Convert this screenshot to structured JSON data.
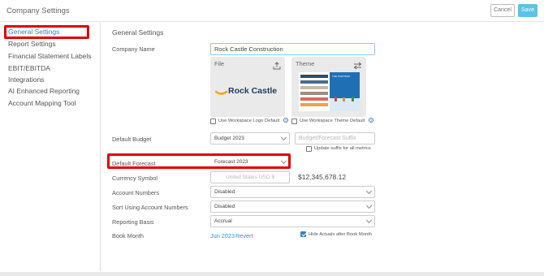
{
  "app": {
    "title": "Company Settings"
  },
  "toolbar": {
    "cancel_label": "Cancel",
    "save_label": "Save"
  },
  "sidebar": {
    "items": [
      {
        "label": "General Settings"
      },
      {
        "label": "Report Settings"
      },
      {
        "label": "Financial Statement Labels"
      },
      {
        "label": "EBIT/EBITDA"
      },
      {
        "label": "Integrations"
      },
      {
        "label": "AI Enhanced Reporting"
      },
      {
        "label": "Account Mapping Tool"
      }
    ],
    "active_index": 0
  },
  "main": {
    "section_title": "General Settings",
    "company_name": {
      "label": "Company Name",
      "value": "Rock Castle Construction"
    },
    "file_panel": {
      "label": "File",
      "logo_text": "Rock Castle",
      "use_default_label": "Use Workspace Logo Default"
    },
    "theme_panel": {
      "label": "Theme",
      "preview_title": "THE FORTISON",
      "use_default_label": "Use Workspace Theme Default"
    },
    "default_budget": {
      "label": "Default Budget",
      "value": "Budget 2023",
      "suffix_placeholder": "Budget/Forecast Suffix",
      "update_suffix_label": "Update suffix for all metrics"
    },
    "default_forecast": {
      "label": "Default Forecast",
      "value": "Forecast 2023"
    },
    "currency_symbol": {
      "label": "Currency Symbol",
      "placeholder": "United States USD $",
      "example": "$12,345,678.12"
    },
    "account_numbers": {
      "label": "Account Numbers",
      "value": "Disabled"
    },
    "sort_account_numbers": {
      "label": "Sort Using Account Numbers",
      "value": "Disabled"
    },
    "reporting_basis": {
      "label": "Reporting Basis",
      "value": "Accrual"
    },
    "book_month": {
      "label": "Book Month",
      "value": "Jun 2023",
      "revert_label": "Revert",
      "hide_actuals_label": "Hide Actuals after Book Month"
    }
  },
  "colors": {
    "accent": "#3a7fc4",
    "save_button": "#5bc3e8",
    "highlight": "#e00000",
    "logo_orange": "#f5a623"
  },
  "icons": {
    "upload": "upload-icon",
    "swap": "swap-arrows-icon",
    "help": "help-icon",
    "chevron": "chevron-down-icon"
  }
}
